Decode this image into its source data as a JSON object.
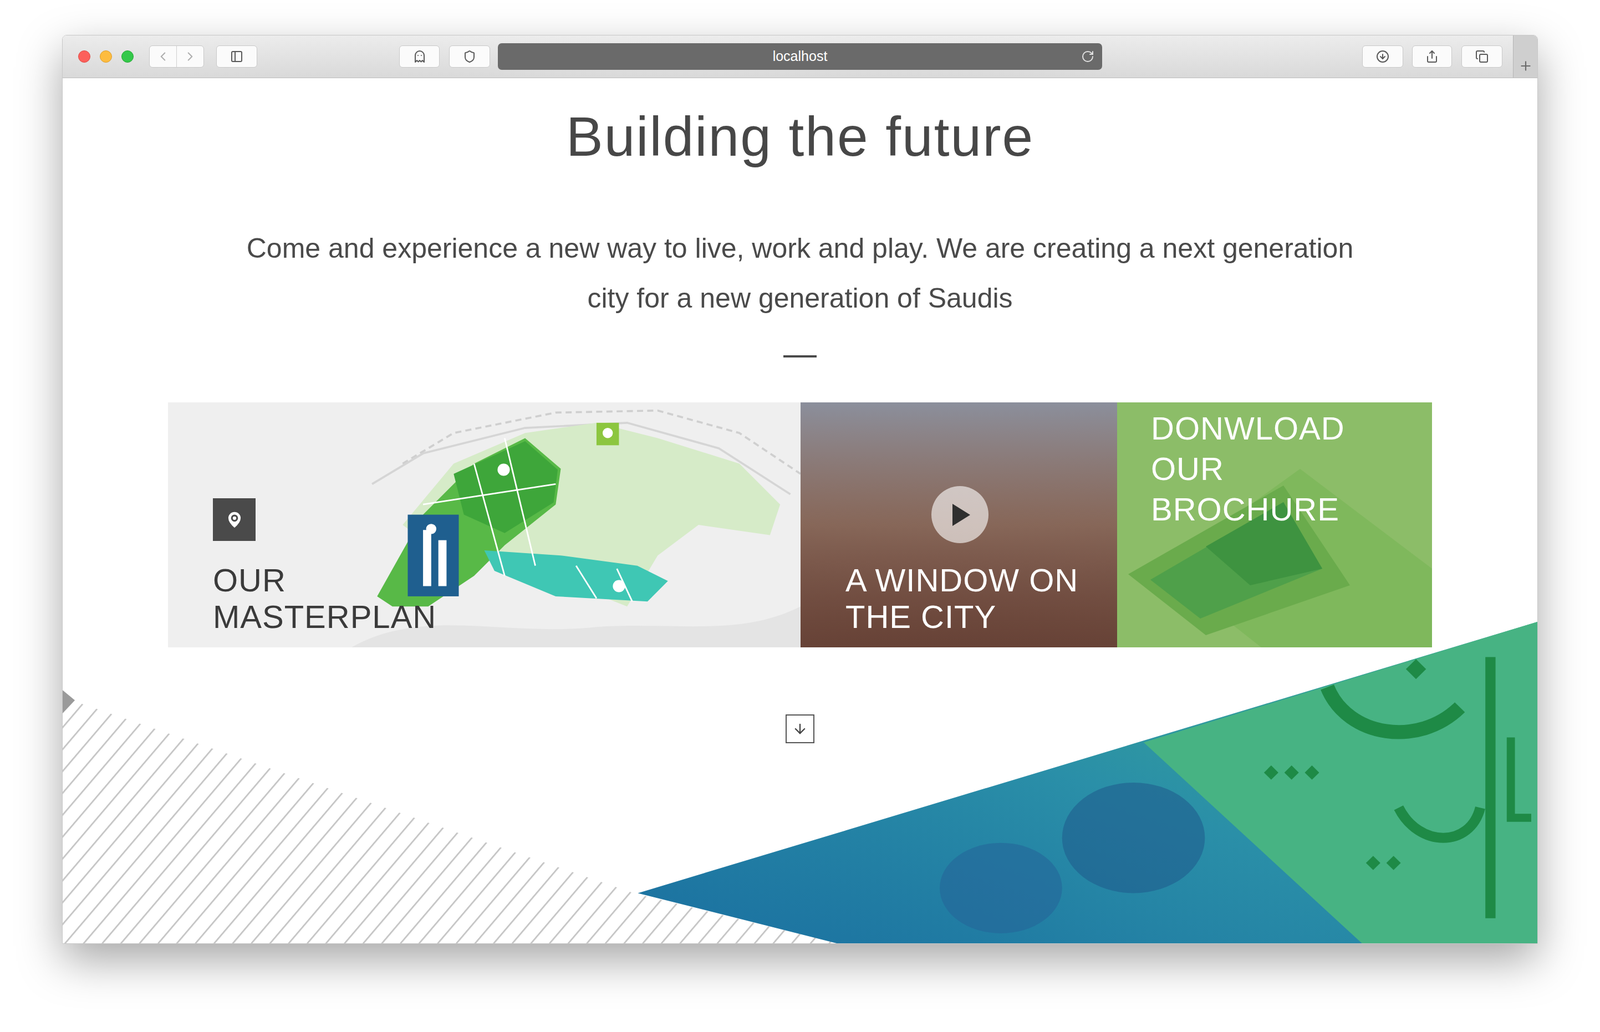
{
  "browser": {
    "url": "localhost"
  },
  "hero": {
    "heading": "Building the future",
    "paragraph": "Come and experience a new way to live, work and play. We are creating a next generation city for a new generation of Saudis"
  },
  "cards": [
    {
      "kind": "map",
      "lines": [
        "OUR",
        "MASTERPLAN"
      ]
    },
    {
      "kind": "video",
      "lines": [
        "A WINDOW ON",
        "THE CITY"
      ]
    },
    {
      "kind": "download",
      "lines": [
        "DONWLOAD",
        "OUR",
        "BROCHURE"
      ]
    }
  ]
}
